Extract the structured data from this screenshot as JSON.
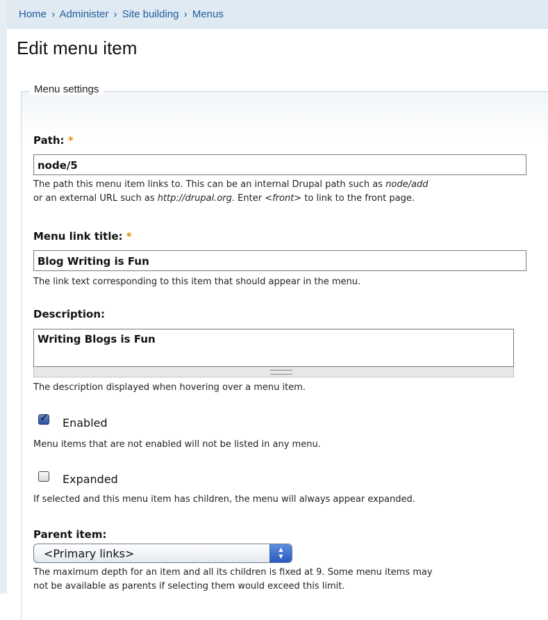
{
  "breadcrumb": [
    "Home",
    "Administer",
    "Site building",
    "Menus"
  ],
  "breadcrumb_separator": "›",
  "page_title": "Edit menu item",
  "fieldset_legend": "Menu settings",
  "required_marker": "*",
  "path": {
    "label": "Path:",
    "value": "node/5",
    "desc_line1_pre": "The path this menu item links to. This can be an internal Drupal path such as ",
    "desc_line1_em": "node/add",
    "desc_line2_pre": "or an external URL such as ",
    "desc_line2_em1": "http://drupal.org",
    "desc_line2_mid": ". Enter ",
    "desc_line2_em2": "<front>",
    "desc_line2_post": " to link to the front page."
  },
  "link_title": {
    "label": "Menu link title:",
    "value": "Blog Writing is Fun",
    "desc": "The link text corresponding to this item that should appear in the menu."
  },
  "description": {
    "label": "Description:",
    "value": "Writing Blogs is Fun",
    "desc": "The description displayed when hovering over a menu item."
  },
  "enabled": {
    "label": "Enabled",
    "checked": true,
    "desc": "Menu items that are not enabled will not be listed in any menu."
  },
  "expanded": {
    "label": "Expanded",
    "checked": false,
    "desc": "If selected and this menu item has children, the menu will always appear expanded."
  },
  "parent": {
    "label": "Parent item:",
    "selected": "<Primary links>",
    "desc_line1": "The maximum depth for an item and all its children is fixed at 9. Some menu items may",
    "desc_line2": "not be available as parents if selecting them would exceed this limit."
  }
}
